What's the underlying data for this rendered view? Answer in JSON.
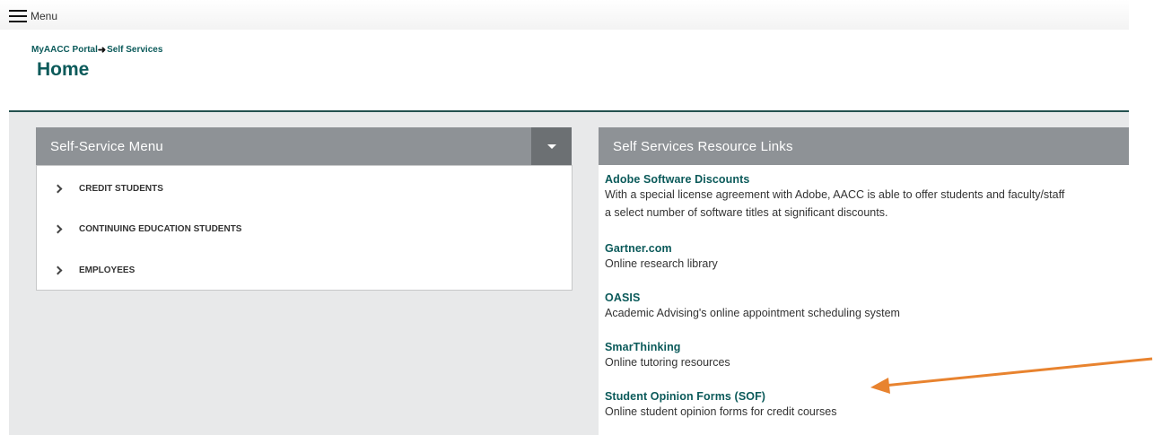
{
  "header": {
    "menu_label": "Menu"
  },
  "breadcrumb": {
    "portal": "MyAACC Portal",
    "current": "Self Services"
  },
  "page_title": "Home",
  "left_panel": {
    "title": "Self-Service Menu",
    "items": [
      {
        "label": "CREDIT STUDENTS"
      },
      {
        "label": "CONTINUING EDUCATION STUDENTS"
      },
      {
        "label": "EMPLOYEES"
      }
    ]
  },
  "right_panel": {
    "title": "Self Services Resource Links",
    "links": [
      {
        "title": "Adobe Software Discounts",
        "desc1": "With a special license agreement with Adobe, AACC is able to offer students and faculty/staff",
        "desc2": "a select number of software titles at significant discounts."
      },
      {
        "title": "Gartner.com",
        "desc1": "Online research library"
      },
      {
        "title": "OASIS",
        "desc1": "Academic Advising's online appointment scheduling system"
      },
      {
        "title": "SmarThinking",
        "desc1": "Online tutoring resources"
      },
      {
        "title": "Student Opinion Forms (SOF)",
        "desc1": "Online student opinion forms for credit courses"
      }
    ]
  },
  "colors": {
    "brand": "#0b5a5a",
    "panel_header": "#8e9296",
    "annotation_arrow": "#e8832f"
  }
}
